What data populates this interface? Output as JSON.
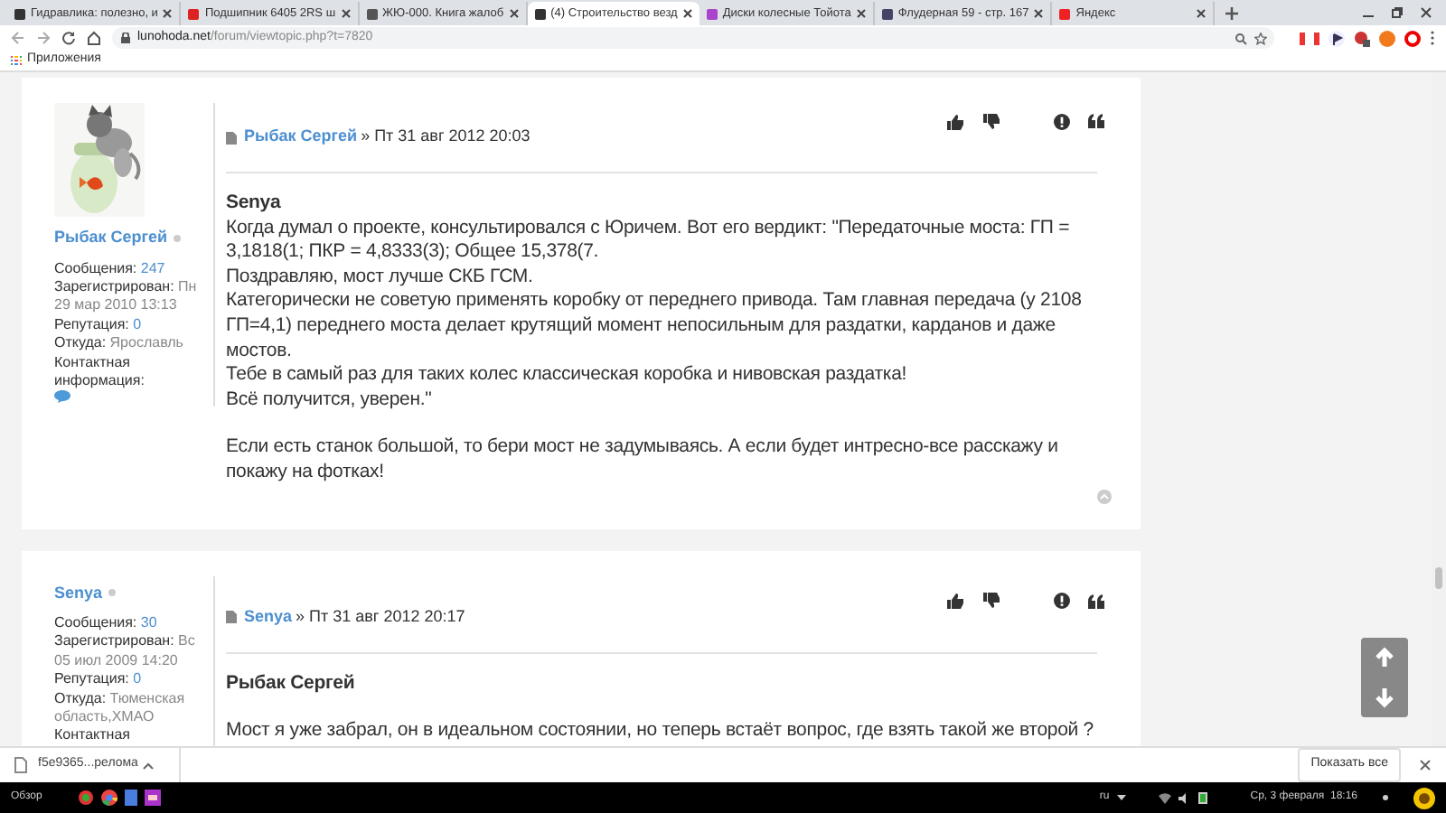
{
  "browser": {
    "tabs": [
      {
        "title": "Гидравлика: полезно, и",
        "selected": false
      },
      {
        "title": "Подшипник 6405 2RS ш",
        "selected": false
      },
      {
        "title": "ЖЮ-000. Книга жалоб",
        "selected": false
      },
      {
        "title": "(4) Строительство везд",
        "selected": true
      },
      {
        "title": "Диски колесные Тойота",
        "selected": false
      },
      {
        "title": "Флудерная 59 - стр. 167",
        "selected": false
      },
      {
        "title": "Яндекс",
        "selected": false
      }
    ],
    "url": {
      "host": "lunohoda.net",
      "path": "/forum/viewtopic.php?t=7820"
    },
    "bookmarks": [
      {
        "label": "Приложения"
      }
    ]
  },
  "posts": [
    {
      "author": "Рыбак Сергей",
      "header_author": "Рыбак Сергей",
      "date": "» Пт 31 авг 2012 20:03",
      "profile": [
        {
          "label": "Сообщения:",
          "value": "247",
          "kind": "link"
        },
        {
          "label": "Зарегистрирован:",
          "value": "Пн 29 мар 2010 13:13",
          "kind": "text"
        },
        {
          "label": "Репутация:",
          "value": "0",
          "kind": "link"
        },
        {
          "label": "Откуда:",
          "value": "Ярославль",
          "kind": "text"
        },
        {
          "label": "Контактная информация:",
          "kind": "icon"
        }
      ],
      "body": [
        {
          "kind": "heading",
          "text": "Senya"
        },
        {
          "kind": "para",
          "text": "Когда думал о проекте, консультировался с Юричем. Вот его вердикт: \"Передаточные моста: ГП = 3,1818(1; ПКР = 4,8333(3); Общее 15,378(7."
        },
        {
          "kind": "para",
          "text": "Поздравляю, мост лучше СКБ ГСМ."
        },
        {
          "kind": "para",
          "text": "Категорически не советую применять коробку от переднего привода. Там главная передача (у 2108 ГП=4,1) переднего моста делает крутящий момент непосильным для раздатки, карданов и даже мостов."
        },
        {
          "kind": "para",
          "text": "Тебе в самый раз для таких колес классическая коробка и нивовская раздатка!"
        },
        {
          "kind": "para",
          "text": "Всё получится, уверен.\""
        },
        {
          "kind": "spaced",
          "text": "Если есть станок большой, то бери мост не задумываясь. А если будет интресно-все расскажу и покажу на фотках!"
        }
      ]
    },
    {
      "author": "Senya",
      "header_author": "Senya",
      "date": "» Пт 31 авг 2012 20:17",
      "profile": [
        {
          "label": "Сообщения:",
          "value": "30",
          "kind": "link"
        },
        {
          "label": "Зарегистрирован:",
          "value": "Вс 05 июл 2009 14:20",
          "kind": "text"
        },
        {
          "label": "Репутация:",
          "value": "0",
          "kind": "link"
        },
        {
          "label": "Откуда:",
          "value": "Тюменская область,ХМАО",
          "kind": "text"
        },
        {
          "label": "Контактная",
          "kind": "cut"
        }
      ],
      "body": [
        {
          "kind": "heading",
          "text": "Рыбак Сергей"
        },
        {
          "kind": "spaced",
          "text": "Мост я уже забрал, он в идеальном состоянии, но теперь встаёт вопрос, где взять такой же второй ?"
        }
      ]
    }
  ],
  "downloads": {
    "file": "f5e9365...релома",
    "show_all": "Показать все"
  },
  "taskbar": {
    "launcher": "Обзор",
    "language": "ru",
    "clock": "Ср, 3 февраля  18:16"
  }
}
